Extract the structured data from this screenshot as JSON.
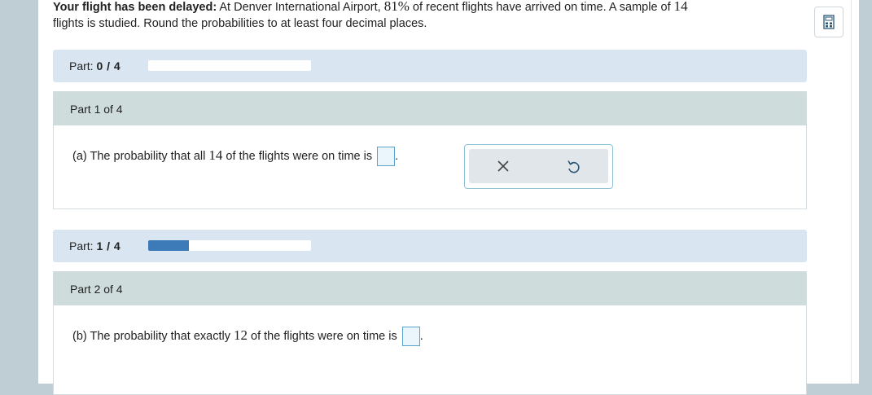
{
  "intro": {
    "bold_lead": "Your flight has been delayed:",
    "text_1": " At Denver International Airport, ",
    "percent": "81%",
    "text_2": " of recent flights have arrived on time. A sample of ",
    "sample_n": "14",
    "text_3": "flights is studied. Round the probabilities to at least four decimal places."
  },
  "parts": [
    {
      "progress_label": "Part:",
      "progress_value": "0 / 4",
      "progress_fraction": 0,
      "section_title": "Part 1 of 4",
      "question_pre": "(a) The probability that all ",
      "question_num": "14",
      "question_post": " of the flights were on time is",
      "answer_value": "",
      "period": "."
    },
    {
      "progress_label": "Part:",
      "progress_value": "1 / 4",
      "progress_fraction": 0.25,
      "section_title": "Part 2 of 4",
      "question_pre": "(b) The probability that exactly ",
      "question_num": "12",
      "question_post": " of the flights were on time is",
      "answer_value": "",
      "period": "."
    }
  ],
  "tools": {
    "clear_icon": "close-icon",
    "undo_icon": "undo-icon"
  },
  "sidebar": {
    "calculator_icon": "calculator-icon"
  },
  "colors": {
    "progress_fill": "#3d7ab8",
    "part_bar_bg": "#d9e6f2",
    "section_head_bg": "#cfdcdc",
    "answer_border": "#5aa3c8"
  }
}
